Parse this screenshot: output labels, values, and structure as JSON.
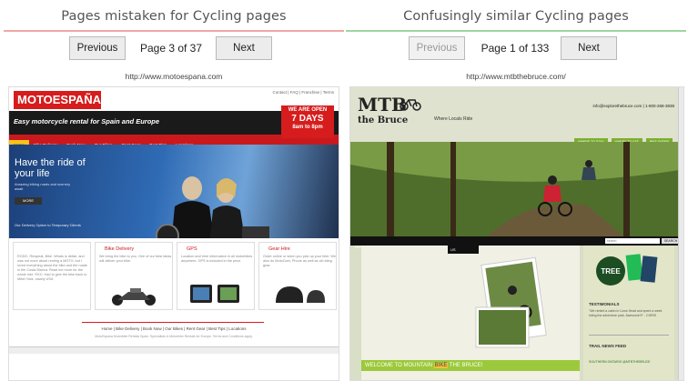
{
  "left": {
    "title": "Pages mistaken for Cycling pages",
    "prev_label": "Previous",
    "page_info": "Page 3 of 37",
    "next_label": "Next",
    "url": "http://www.motoespana.com",
    "site": {
      "logo": "MOTOESPAÑA",
      "top_links": "Contact | FAQ | Franchise | Terms",
      "tagline": "Easy motorcycle rental for Spain and Europe",
      "open_line1": "WE ARE OPEN",
      "open_line2": "7 DAYS",
      "open_line3": "8am to 8pm",
      "nav": [
        "Home",
        "Bike Delivery",
        "Book Now",
        "Our Bikes",
        "Rent Gear",
        "Best Tips",
        "Locations"
      ],
      "hero_heading": "Have the ride of your life",
      "hero_sub": "Amazing biking roads and scenery await",
      "hero_more": "MORE",
      "hero_note": "Our Delivery Option to Temporary Clients",
      "boxes": [
        {
          "title": "",
          "text": "RODO, Rewpeat, Bike. Whats is defab, and was not more about renting a MOTO; but I loved everything about the bike and the roads in the Costa Blanca. Read me more for the whole ride. RXC: Had to give the bike back to Mike!  Nick, vaiarly USA"
        },
        {
          "title": "Bike Delivery",
          "text": "We bring the bike to you. One of our best ideas will deliver your bike."
        },
        {
          "title": "GPS",
          "text": "Location and time information in all motorbikes anywhere. GPS is included in the price."
        },
        {
          "title": "Gear Hire",
          "text": "Order online or when you pick up your bike. We also do MotoCam, Phone as well as all riding gear."
        }
      ],
      "footer_links": "Home | Bike Delivery | Book Now | Our Bikes | Rent Gear | Best Tips | Locations",
      "footer_small": "MotoEspana Motorbike Rentals Spain. Specialists in Motorbike Rentals for Europe. Terms and Conditions apply."
    }
  },
  "right": {
    "title": "Confusingly similar Cycling pages",
    "prev_label": "Previous",
    "page_info": "Page 1 of 133",
    "next_label": "Next",
    "url": "http://www.mtbthebruce.com/",
    "site": {
      "logo_main": "MTB",
      "logo_sub": "the Bruce",
      "tagline": "Where Locals Ride",
      "contact": "info@explorethebruce.com   |   1-800-268-3838",
      "tabs": [
        "WHERE TO STAY",
        "WHERE TO EAT",
        "BIKE SHOPS"
      ],
      "nav": [
        "HOME",
        "TRAILS ▾",
        "ABOUT US",
        "CONTACT US"
      ],
      "search_placeholder": "search",
      "search_button": "SEARCH",
      "dropdown_item": "US",
      "welcome_prefix": "WELCOME TO MOUNTAIN ",
      "welcome_highlight": "BIKE",
      "welcome_suffix": " THE BRUCE!",
      "badge": "TREE",
      "testimonials_title": "TESTIMONIALS",
      "testimonial_text": "\"We rented a cabin in Lions Head and spent a week riding the adventure park. Awesome!!!\" - CHRIS",
      "news_title": "TRAIL NEWS FEED",
      "twitter_name": "SOUTHERN ONTARIO @MTBTHEBRUCE"
    }
  },
  "colors": {
    "left_rule": "#f2a7a7",
    "right_rule": "#9fd69f",
    "moto_red": "#d61c1c",
    "mtb_green": "#7cae2f"
  }
}
